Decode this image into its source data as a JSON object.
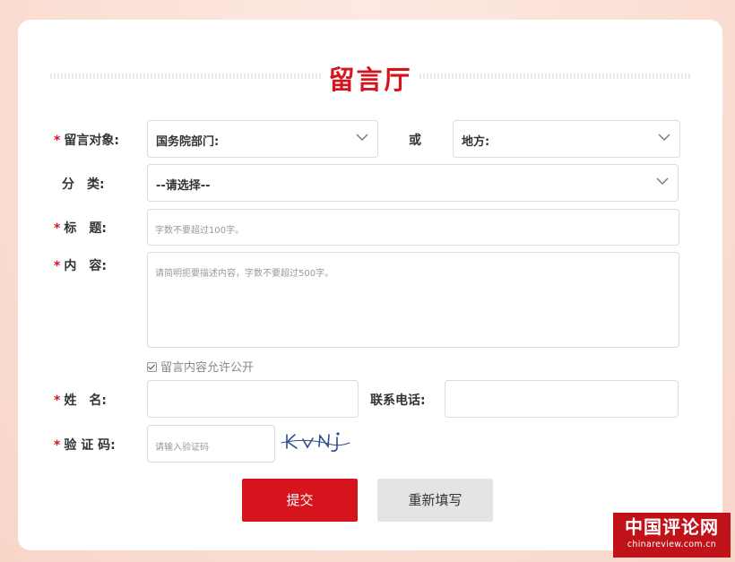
{
  "page": {
    "title": "留言厅"
  },
  "form": {
    "target": {
      "required_mark": "*",
      "label": "留言对象:",
      "dept_select_value": "国务院部门:",
      "or_label": "或",
      "local_select_value": "地方:"
    },
    "category": {
      "label": "分　类:",
      "select_value": "--请选择--"
    },
    "subject": {
      "required_mark": "*",
      "label": "标　题:",
      "placeholder": "字数不要超过100字。"
    },
    "content": {
      "required_mark": "*",
      "label": "内　容:",
      "placeholder": "请简明扼要描述内容，字数不要超过500字。"
    },
    "public_checkbox": {
      "checked": true,
      "label": "留言内容允许公开"
    },
    "name": {
      "required_mark": "*",
      "label": "姓　名:"
    },
    "phone": {
      "label": "联系电话:"
    },
    "captcha": {
      "required_mark": "*",
      "label": "验 证 码:",
      "placeholder": "请输入验证码",
      "image_text": "KVNj"
    }
  },
  "buttons": {
    "submit_label": "提交",
    "reset_label": "重新填写"
  },
  "watermark": {
    "name": "中国评论网",
    "url": "chinareview.com.cn"
  },
  "colors": {
    "accent": "#d5141e",
    "captcha_ink": "#2c4f8c"
  },
  "icons": {
    "dropdown": "chevron-down-icon",
    "checkbox": "checkmark-icon"
  }
}
